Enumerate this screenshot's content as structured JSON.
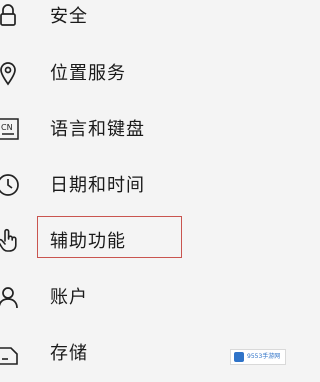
{
  "menu": {
    "items": [
      {
        "label": "安全",
        "icon": "lock-icon"
      },
      {
        "label": "位置服务",
        "icon": "location-pin-icon"
      },
      {
        "label": "语言和键盘",
        "icon": "keyboard-language-icon"
      },
      {
        "label": "日期和时间",
        "icon": "clock-icon"
      },
      {
        "label": "辅助功能",
        "icon": "hand-pointer-icon",
        "selected": true
      },
      {
        "label": "账户",
        "icon": "user-icon"
      },
      {
        "label": "存储",
        "icon": "storage-icon"
      }
    ]
  },
  "watermark": {
    "text": "9553手游网"
  },
  "colors": {
    "background": "#f4f4f4",
    "text": "#1a1a1a",
    "highlight_border": "#c9544f",
    "watermark_blue": "#2f73c8"
  }
}
